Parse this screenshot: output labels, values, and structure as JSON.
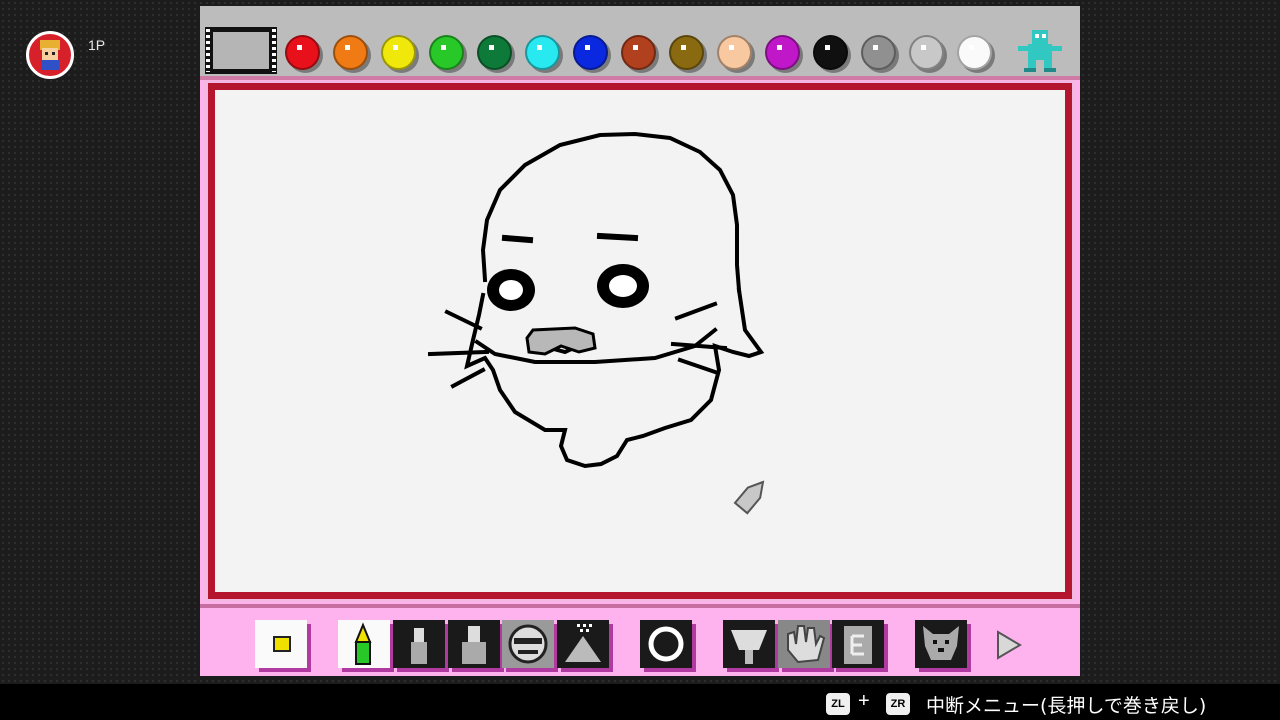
{
  "player": {
    "label": "1P",
    "icon": "player-avatar-icon"
  },
  "palette": {
    "colors": [
      "#e8101a",
      "#f07a14",
      "#f0e80a",
      "#28c828",
      "#0e7a3a",
      "#28e8f0",
      "#0a28e0",
      "#b0401e",
      "#8a6a10",
      "#f8c8a0",
      "#c018c8",
      "#101010",
      "#909090",
      "#c8c8c8",
      "#fafafa"
    ],
    "mascot_icon": "mascot-icon",
    "film_icon": "film-strip-icon"
  },
  "tools": [
    {
      "name": "color-swatch-tool",
      "icon": "current-color-icon"
    },
    {
      "name": "pencil-tool",
      "icon": "pencil-icon"
    },
    {
      "name": "marker-small-tool",
      "icon": "marker-icon"
    },
    {
      "name": "marker-large-tool",
      "icon": "marker-icon"
    },
    {
      "name": "stamp-tool",
      "icon": "stamp-face-icon"
    },
    {
      "name": "spray-tool",
      "icon": "spray-icon"
    },
    {
      "name": "shape-tool",
      "icon": "circle-icon"
    },
    {
      "name": "fill-tool",
      "icon": "paint-bucket-icon"
    },
    {
      "name": "undo-tool",
      "icon": "hand-icon"
    },
    {
      "name": "eraser-tool",
      "icon": "eraser-icon"
    },
    {
      "name": "sound-tool",
      "icon": "dog-icon"
    },
    {
      "name": "next-tool",
      "icon": "play-arrow-icon"
    }
  ],
  "footer": {
    "zl_label": "ZL",
    "plus": "+",
    "zr_label": "ZR",
    "menu_text": "中断メニュー(長押しで巻き戻し)"
  }
}
